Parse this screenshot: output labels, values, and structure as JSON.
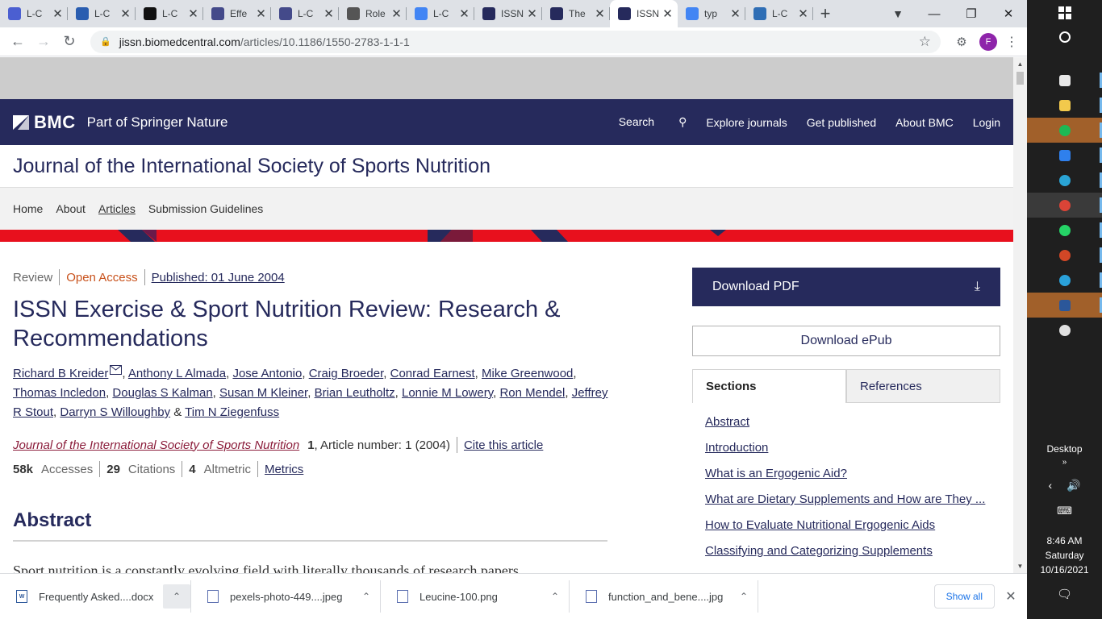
{
  "browser": {
    "tabs": [
      {
        "title": "L-C",
        "favicon_color": "#4b5fd1",
        "active": false
      },
      {
        "title": "L-C",
        "favicon_color": "#2a5db0",
        "active": false
      },
      {
        "title": "L-C",
        "favicon_color": "#111111",
        "active": false
      },
      {
        "title": "Effe",
        "favicon_color": "#444a8a",
        "active": false
      },
      {
        "title": "L-C",
        "favicon_color": "#444a8a",
        "active": false
      },
      {
        "title": "Role",
        "favicon_color": "#555555",
        "active": false
      },
      {
        "title": "L-C",
        "favicon_color": "#4285f4",
        "active": false
      },
      {
        "title": "ISSN",
        "favicon_color": "#262a5c",
        "active": false
      },
      {
        "title": "The",
        "favicon_color": "#262a5c",
        "active": false
      },
      {
        "title": "ISSN",
        "favicon_color": "#262a5c",
        "active": true
      },
      {
        "title": "typ",
        "favicon_color": "#4285f4",
        "active": false
      },
      {
        "title": "L-C",
        "favicon_color": "#2f6eb5",
        "active": false
      }
    ],
    "url_host": "jissn.biomedcentral.com",
    "url_path": "/articles/10.1186/1550-2783-1-1-1",
    "profile_initial": "F"
  },
  "site": {
    "brand": "BMC",
    "tagline": "Part of Springer Nature",
    "nav": {
      "search": "Search",
      "explore": "Explore journals",
      "get_published": "Get published",
      "about": "About BMC",
      "login": "Login"
    },
    "journal_title": "Journal of the International Society of Sports Nutrition",
    "subnav": {
      "home": "Home",
      "about": "About",
      "articles": "Articles",
      "guidelines": "Submission Guidelines"
    }
  },
  "article": {
    "type": "Review",
    "access": "Open Access",
    "published": "Published: 01 June 2004",
    "title": "ISSN Exercise & Sport Nutrition Review: Research & Recommendations",
    "authors": [
      "Richard B Kreider",
      "Anthony L Almada",
      "Jose Antonio",
      "Craig Broeder",
      "Conrad Earnest",
      "Mike Greenwood",
      "Thomas Incledon",
      "Douglas S Kalman",
      "Susan M Kleiner",
      "Brian Leutholtz",
      "Lonnie M Lowery",
      "Ron Mendel",
      "Jeffrey R Stout",
      "Darryn S Willoughby",
      "Tim N Ziegenfuss"
    ],
    "journal_name": "Journal of the International Society of Sports Nutrition",
    "volume": "1",
    "article_number": ", Article number: 1 (2004)",
    "cite": "Cite this article",
    "accesses_value": "58k",
    "accesses_label": "Accesses",
    "citations_value": "29",
    "citations_label": "Citations",
    "altmetric_value": "4",
    "altmetric_label": "Altmetric",
    "metrics": "Metrics",
    "abstract_heading": "Abstract",
    "abstract_text": "Sport nutrition is a constantly evolving field with literally thousands of research papers"
  },
  "sidebar": {
    "download_pdf": "Download PDF",
    "download_epub": "Download ePub",
    "tab_sections": "Sections",
    "tab_references": "References",
    "sections": [
      "Abstract",
      "Introduction",
      "What is an Ergogenic Aid?",
      "What are Dietary Supplements and How are They ...",
      "How to Evaluate Nutritional Ergogenic Aids",
      "Classifying and Categorizing Supplements"
    ]
  },
  "downloads": {
    "items": [
      {
        "name": "Frequently Asked....docx",
        "icon": "word-doc-icon"
      },
      {
        "name": "pexels-photo-449....jpeg",
        "icon": "image-file-icon"
      },
      {
        "name": "Leucine-100.png",
        "icon": "image-file-icon"
      },
      {
        "name": "function_and_bene....jpg",
        "icon": "image-file-icon"
      }
    ],
    "show_all": "Show all"
  },
  "taskbar": {
    "desktop": "Desktop",
    "time": "8:46 AM",
    "day": "Saturday",
    "date": "10/16/2021",
    "apps": [
      {
        "name": "store-icon",
        "color": "#e8e8e8",
        "highlight": "",
        "pip": true
      },
      {
        "name": "file-explorer-icon",
        "color": "#f2c94c",
        "highlight": "",
        "pip": true
      },
      {
        "name": "spotify-icon",
        "color": "#1db954",
        "highlight": "hl",
        "pip": true
      },
      {
        "name": "mail-icon",
        "color": "#2f80ed",
        "highlight": "",
        "pip": true
      },
      {
        "name": "edge-icon",
        "color": "#2aa4d5",
        "highlight": "",
        "pip": true
      },
      {
        "name": "chrome-icon",
        "color": "#db4437",
        "highlight": "hl2",
        "pip": true
      },
      {
        "name": "whatsapp-icon",
        "color": "#25d366",
        "highlight": "",
        "pip": true
      },
      {
        "name": "powerpoint-icon",
        "color": "#d24726",
        "highlight": "",
        "pip": true
      },
      {
        "name": "telegram-icon",
        "color": "#2aa1da",
        "highlight": "",
        "pip": true
      },
      {
        "name": "word-icon",
        "color": "#2b579a",
        "highlight": "hl",
        "pip": true
      },
      {
        "name": "media-icon",
        "color": "#e0e0e0",
        "highlight": "",
        "pip": false
      }
    ]
  }
}
